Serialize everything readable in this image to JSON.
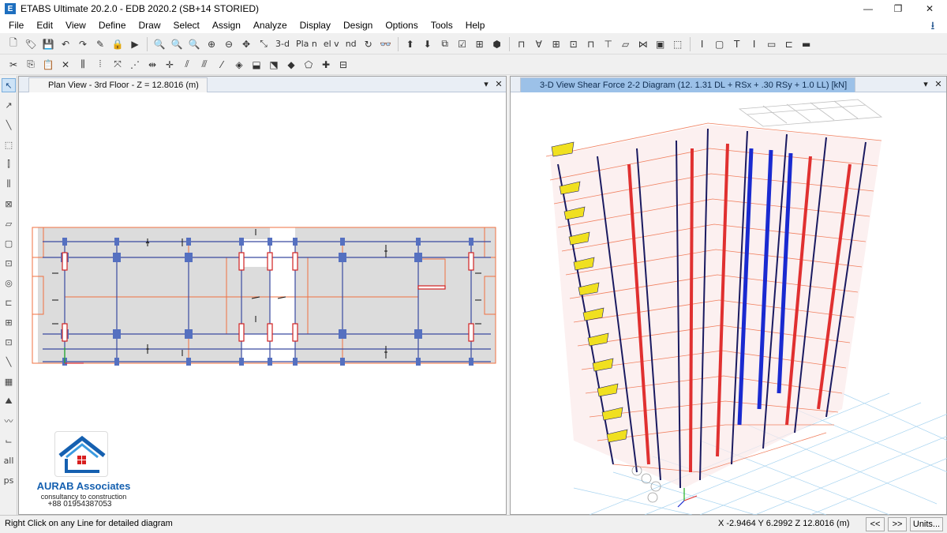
{
  "window": {
    "title": "ETABS Ultimate 20.2.0 - EDB 2020.2 (SB+14 STORIED)",
    "app_icon_letter": "E",
    "minimize": "—",
    "restore": "❐",
    "close": "✕"
  },
  "menu": [
    "File",
    "Edit",
    "View",
    "Define",
    "Draw",
    "Select",
    "Assign",
    "Analyze",
    "Display",
    "Design",
    "Options",
    "Tools",
    "Help"
  ],
  "toolbar": {
    "view_3d": "3-d",
    "view_plan": "Pla n",
    "view_elev": "el v",
    "view_nd": "nd"
  },
  "left_panel": {
    "tab_title": "Plan View - 3rd Floor - Z = 12.8016 (m)",
    "pin": "▾",
    "close": "✕"
  },
  "right_panel": {
    "tab_title": "3-D View   Shear Force 2-2 Diagram   (12. 1.31 DL + RSx + .30 RSy + 1.0 LL)  [kN]",
    "pin": "▾",
    "close": "✕"
  },
  "status": {
    "message": "Right Click on any Line for detailed diagram",
    "coordinates": "X -2.9464  Y 6.2992  Z 12.8016 (m)",
    "prev_button": "<<",
    "next_button": ">>",
    "units_button": "Units..."
  },
  "watermark": {
    "name": "AURAB Associates",
    "tagline": "consultancy to construction",
    "phone": "+88 01954387053"
  },
  "colors": {
    "grid_blue": "#3a4aa0",
    "beam_orange": "#f07040",
    "column_fill": "#5570c0",
    "slab_gray": "#d9d9d9",
    "shear_red": "#e03030",
    "shear_yellow": "#f0e020",
    "shear_blue": "#1a2ad0"
  }
}
